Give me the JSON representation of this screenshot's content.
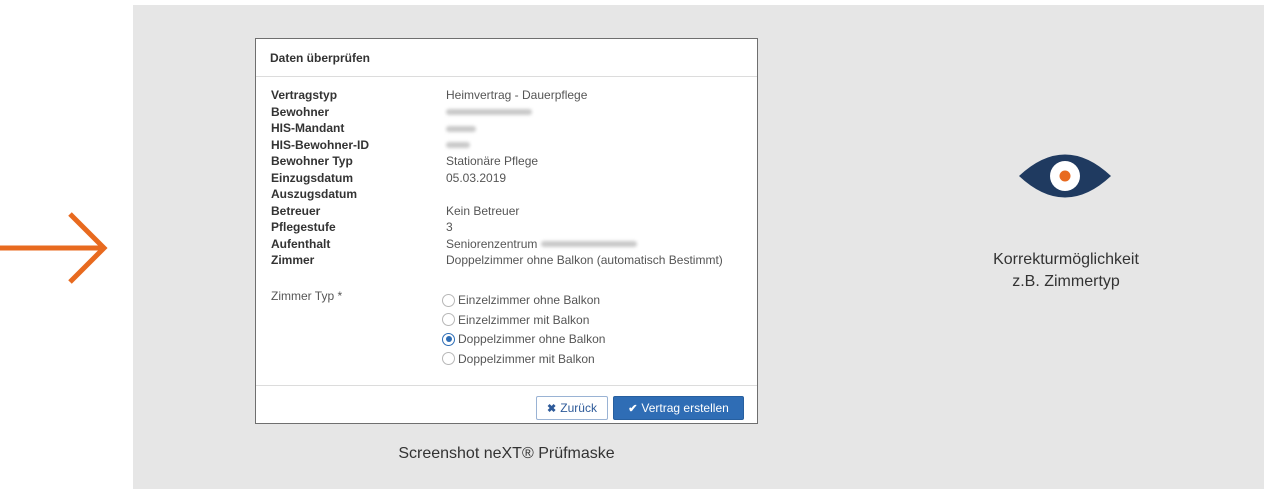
{
  "colors": {
    "accent_orange": "#e86a1f",
    "eye_navy": "#1f3a60",
    "panel_gray": "#e6e6e6",
    "primary_blue": "#2f6db5"
  },
  "dialog": {
    "title": "Daten überprüfen",
    "details": [
      {
        "label": "Vertragstyp",
        "value": "Heimvertrag - Dauerpflege"
      },
      {
        "label": "Bewohner",
        "value": ""
      },
      {
        "label": "HIS-Mandant",
        "value": ""
      },
      {
        "label": "HIS-Bewohner-ID",
        "value": ""
      },
      {
        "label": "Bewohner Typ",
        "value": "Stationäre Pflege"
      },
      {
        "label": "Einzugsdatum",
        "value": "05.03.2019"
      },
      {
        "label": "Auszugsdatum",
        "value": ""
      },
      {
        "label": "Betreuer",
        "value": "Kein Betreuer"
      },
      {
        "label": "Pflegestufe",
        "value": "3"
      },
      {
        "label": "Aufenthalt",
        "value": "Seniorenzentrum"
      },
      {
        "label": "Zimmer",
        "value": "Doppelzimmer ohne Balkon (automatisch Bestimmt)"
      }
    ],
    "zimmer_typ_label": "Zimmer Typ *",
    "room_options": [
      {
        "label": "Einzelzimmer ohne Balkon",
        "selected": false
      },
      {
        "label": "Einzelzimmer mit Balkon",
        "selected": false
      },
      {
        "label": "Doppelzimmer ohne Balkon",
        "selected": true
      },
      {
        "label": "Doppelzimmer mit Balkon",
        "selected": false
      }
    ],
    "back_button": "Zurück",
    "create_button": "Vertrag erstellen"
  },
  "caption": "Screenshot neXT® Prüfmaske",
  "note": {
    "line1": "Korrekturmöglichkeit",
    "line2": "z.B. Zimmertyp"
  },
  "icons": {
    "arrow": "arrow-right-icon",
    "eye": "eye-icon",
    "back": "x-icon",
    "create": "check-icon"
  }
}
